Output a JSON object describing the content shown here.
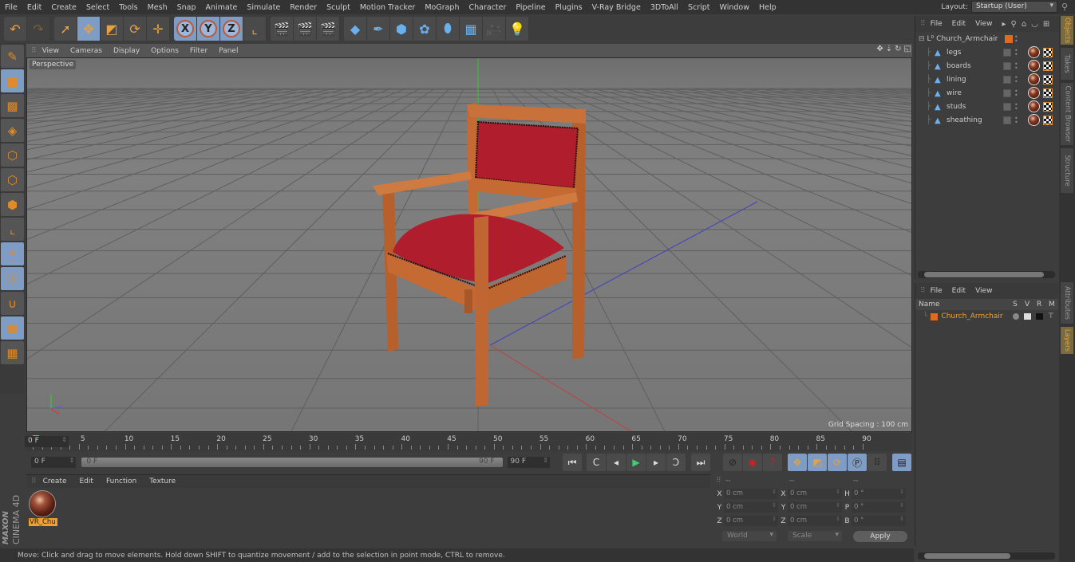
{
  "menubar": {
    "items": [
      "File",
      "Edit",
      "Create",
      "Select",
      "Tools",
      "Mesh",
      "Snap",
      "Animate",
      "Simulate",
      "Render",
      "Sculpt",
      "Motion Tracker",
      "MoGraph",
      "Character",
      "Pipeline",
      "Plugins",
      "V-Ray Bridge",
      "3DToAll",
      "Script",
      "Window",
      "Help"
    ],
    "layout_label": "Layout:",
    "layout_value": "Startup (User)"
  },
  "toolbar": {
    "groups": [
      [
        {
          "icon": "undo-icon",
          "glyph": "↶",
          "on": false
        },
        {
          "icon": "redo-icon",
          "glyph": "↷",
          "on": false,
          "dim": true
        }
      ],
      [
        {
          "icon": "live-selection-icon",
          "glyph": "➚",
          "on": false
        },
        {
          "icon": "move-icon",
          "glyph": "✥",
          "on": true
        },
        {
          "icon": "scale-icon",
          "glyph": "◩",
          "on": false
        },
        {
          "icon": "rotate-icon",
          "glyph": "⟳",
          "on": false
        },
        {
          "icon": "add-icon",
          "glyph": "✛",
          "on": false
        }
      ],
      [
        {
          "icon": "x-axis-icon",
          "letter": "X",
          "on": true
        },
        {
          "icon": "y-axis-icon",
          "letter": "Y",
          "on": true
        },
        {
          "icon": "z-axis-icon",
          "letter": "Z",
          "on": true
        },
        {
          "icon": "coordinate-system-icon",
          "glyph": "⌞",
          "on": false
        }
      ],
      [
        {
          "icon": "render-view-icon",
          "glyph": "🎬",
          "on": false
        },
        {
          "icon": "render-picture-viewer-icon",
          "glyph": "🎬",
          "on": false
        },
        {
          "icon": "render-settings-icon",
          "glyph": "🎬",
          "on": false
        }
      ],
      [
        {
          "icon": "cube-icon",
          "glyph": "◆",
          "on": false
        },
        {
          "icon": "pen-icon",
          "glyph": "✒",
          "on": false
        },
        {
          "icon": "subdivision-icon",
          "glyph": "⬢",
          "on": false
        },
        {
          "icon": "array-icon",
          "glyph": "✿",
          "on": false
        },
        {
          "icon": "deformer-icon",
          "glyph": "⬮",
          "on": false
        },
        {
          "icon": "floor-icon",
          "glyph": "▦",
          "on": false
        },
        {
          "icon": "camera-icon",
          "glyph": "🎥",
          "on": false
        },
        {
          "icon": "light-icon",
          "glyph": "💡",
          "on": false
        }
      ]
    ]
  },
  "lefttools": [
    {
      "icon": "make-editable-icon",
      "glyph": "✎",
      "on": false
    },
    {
      "icon": "model-mode-icon",
      "glyph": "■",
      "on": true
    },
    {
      "icon": "texture-mode-icon",
      "glyph": "▩",
      "on": false
    },
    {
      "icon": "workplane-icon",
      "glyph": "◈",
      "on": false
    },
    {
      "icon": "points-mode-icon",
      "glyph": "⬡",
      "on": false
    },
    {
      "icon": "edges-mode-icon",
      "glyph": "⬡",
      "on": false
    },
    {
      "icon": "polygons-mode-icon",
      "glyph": "⬢",
      "on": false
    },
    {
      "icon": "axis-mode-icon",
      "glyph": "⌞",
      "on": false
    },
    {
      "icon": "tweak-mode-icon",
      "glyph": "🖱",
      "on": true
    },
    {
      "icon": "solo-icon",
      "glyph": "Ⓢ",
      "on": true
    },
    {
      "icon": "snap-icon",
      "glyph": "∪",
      "on": false
    },
    {
      "icon": "lock-workplane-icon",
      "glyph": "▦",
      "on": true
    },
    {
      "icon": "planar-workplane-icon",
      "glyph": "▦",
      "on": false
    }
  ],
  "viewport": {
    "menu": [
      "View",
      "Cameras",
      "Display",
      "Options",
      "Filter",
      "Panel"
    ],
    "label": "Perspective",
    "grid_spacing": "Grid Spacing : 100 cm"
  },
  "timeline": {
    "ticks": [
      "0",
      "5",
      "10",
      "15",
      "20",
      "25",
      "30",
      "35",
      "40",
      "45",
      "50",
      "55",
      "60",
      "65",
      "70",
      "75",
      "80",
      "85",
      "90"
    ],
    "current_frame": "0 F",
    "start_field": "0 F",
    "range_start": "0 F",
    "range_end": "90 F",
    "end_field": "90 F"
  },
  "transport": [
    {
      "icon": "goto-start-icon",
      "glyph": "⏮"
    },
    {
      "icon": "prev-key-icon",
      "glyph": "C"
    },
    {
      "icon": "prev-frame-icon",
      "glyph": "◂"
    },
    {
      "icon": "play-icon",
      "glyph": "▶"
    },
    {
      "icon": "next-frame-icon",
      "glyph": "▸"
    },
    {
      "icon": "next-key-icon",
      "glyph": "Ɔ"
    },
    {
      "icon": "goto-end-icon",
      "glyph": "⏭"
    }
  ],
  "keytools": [
    {
      "icon": "motion-record-icon",
      "glyph": "⊘",
      "on": false
    },
    {
      "icon": "record-active-icon",
      "glyph": "◉",
      "on": false
    },
    {
      "icon": "autokey-icon",
      "glyph": "?",
      "on": false
    },
    {
      "icon": "key-position-icon",
      "glyph": "✥",
      "on": true
    },
    {
      "icon": "key-scale-icon",
      "glyph": "◩",
      "on": true
    },
    {
      "icon": "key-rotation-icon",
      "glyph": "⟳",
      "on": true
    },
    {
      "icon": "key-param-icon",
      "glyph": "Ⓟ",
      "on": true
    },
    {
      "icon": "key-pla-icon",
      "glyph": "⠿",
      "on": false
    },
    {
      "icon": "timeline-icon",
      "glyph": "▤",
      "on": true
    }
  ],
  "material_manager": {
    "menu": [
      "Create",
      "Edit",
      "Function",
      "Texture"
    ],
    "materials": [
      {
        "name": "VR_Chu"
      }
    ]
  },
  "brand": {
    "maxon": "MAXON",
    "product": "CINEMA 4D"
  },
  "coordinates": {
    "headers": [
      "--",
      "--",
      "--"
    ],
    "rows": [
      {
        "l1": "X",
        "v1": "0 cm",
        "l2": "X",
        "v2": "0 cm",
        "l3": "H",
        "v3": "0 °"
      },
      {
        "l1": "Y",
        "v1": "0 cm",
        "l2": "Y",
        "v2": "0 cm",
        "l3": "P",
        "v3": "0 °"
      },
      {
        "l1": "Z",
        "v1": "0 cm",
        "l2": "Z",
        "v2": "0 cm",
        "l3": "B",
        "v3": "0 °"
      }
    ],
    "mode": "World",
    "transform": "Scale",
    "apply": "Apply"
  },
  "status": "Move: Click and drag to move elements. Hold down SHIFT to quantize movement / add to the selection in point mode, CTRL to remove.",
  "object_manager": {
    "menu": [
      "File",
      "Edit",
      "View"
    ],
    "root": "Church_Armchair",
    "children": [
      "legs",
      "boards",
      "lining",
      "wire",
      "studs",
      "sheathing"
    ]
  },
  "layer_manager": {
    "menu": [
      "File",
      "Edit",
      "View"
    ],
    "columns": {
      "name": "Name",
      "s": "S",
      "v": "V",
      "r": "R",
      "m": "M"
    },
    "layers": [
      {
        "name": "Church_Armchair",
        "color": "#e06a20"
      }
    ]
  },
  "side_tabs": {
    "top": [
      {
        "label": "Objects",
        "on": true
      },
      {
        "label": "Takes",
        "on": false
      },
      {
        "label": "Content Browser",
        "on": false
      },
      {
        "label": "Structure",
        "on": false
      }
    ],
    "bottom": [
      {
        "label": "Attributes",
        "on": false
      },
      {
        "label": "Layers",
        "on": true
      }
    ]
  },
  "colors": {
    "accent_orange": "#f0a030",
    "active_blue": "#7f9cc4",
    "play_green": "#3fcf70"
  }
}
